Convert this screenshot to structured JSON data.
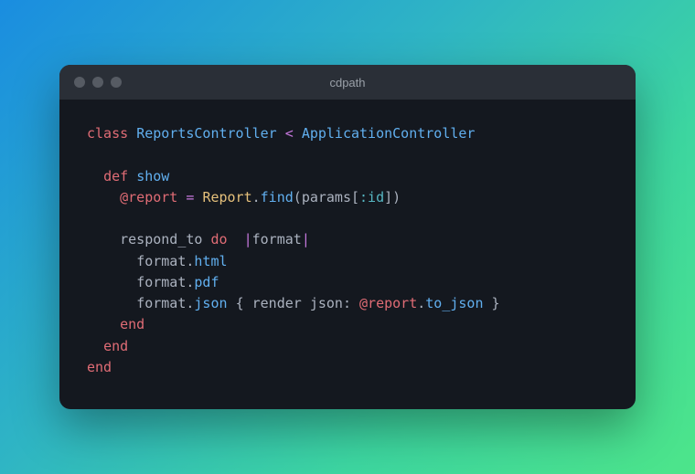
{
  "window": {
    "title": "cdpath"
  },
  "code": {
    "l1": {
      "kw1": "class",
      "cls1": "ReportsController",
      "op1": "<",
      "cls2": "ApplicationController"
    },
    "l3": {
      "kw1": "def",
      "fn1": "show"
    },
    "l4": {
      "ivar1": "@report",
      "op1": "=",
      "cls1": "Report",
      "dot1": ".",
      "m1": "find",
      "p1": "(",
      "id1": "params",
      "b1": "[",
      "sym1": ":id",
      "b2": "]",
      "p2": ")"
    },
    "l6": {
      "id1": "respond_to",
      "kw1": "do",
      "op1": "|",
      "id2": "format",
      "op2": "|"
    },
    "l7": {
      "id1": "format",
      "dot1": ".",
      "m1": "html"
    },
    "l8": {
      "id1": "format",
      "dot1": ".",
      "m1": "pdf"
    },
    "l9": {
      "id1": "format",
      "dot1": ".",
      "m1": "json",
      "b1": "{",
      "id2": "render",
      "id3": "json:",
      "ivar1": "@report",
      "dot2": ".",
      "m2": "to_json",
      "b2": "}"
    },
    "l10": {
      "kw1": "end"
    },
    "l11": {
      "kw1": "end"
    },
    "l12": {
      "kw1": "end"
    }
  }
}
